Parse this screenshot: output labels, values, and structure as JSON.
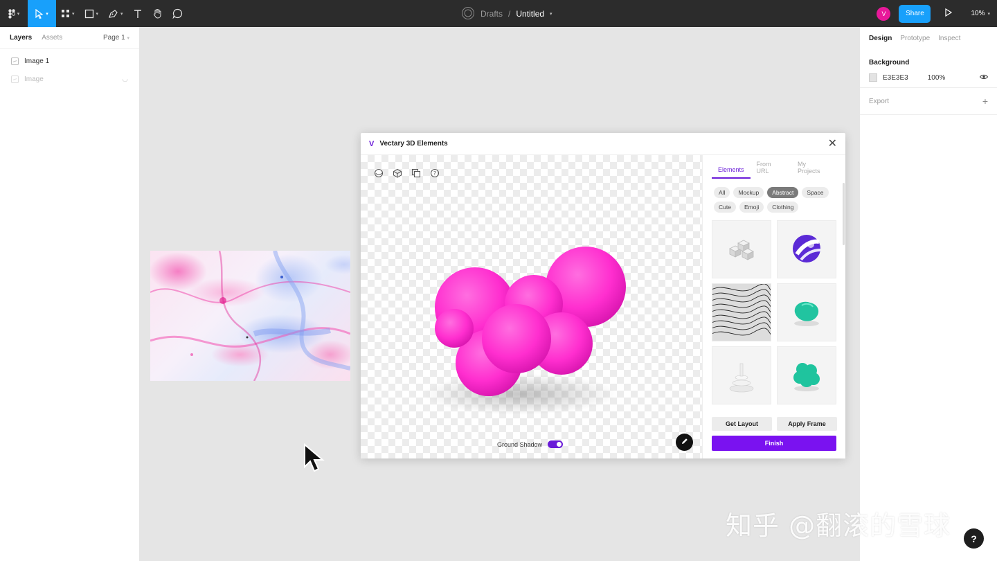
{
  "toolbar": {
    "tools": [
      {
        "name": "main-menu",
        "icon": "figma-logo-icon"
      },
      {
        "name": "move-tool",
        "icon": "cursor-arrow-icon",
        "active": true
      },
      {
        "name": "frame-tool",
        "icon": "frame-grid-icon"
      },
      {
        "name": "shape-tool",
        "icon": "rectangle-icon"
      },
      {
        "name": "pen-tool",
        "icon": "pen-icon"
      },
      {
        "name": "text-tool",
        "icon": "text-t-icon"
      },
      {
        "name": "hand-tool",
        "icon": "hand-icon"
      },
      {
        "name": "comment-tool",
        "icon": "speech-bubble-icon"
      }
    ],
    "breadcrumb_folder": "Drafts",
    "breadcrumb_sep": "/",
    "file_name": "Untitled",
    "avatar_initial": "V",
    "share_label": "Share",
    "zoom": "10%",
    "accent": "#18a0fb"
  },
  "left_panel": {
    "tab_layers": "Layers",
    "tab_assets": "Assets",
    "page": "Page 1",
    "layers": [
      {
        "label": "Image 1",
        "dim": false
      },
      {
        "label": "Image",
        "dim": true
      }
    ]
  },
  "right_panel": {
    "tab_design": "Design",
    "tab_prototype": "Prototype",
    "tab_inspect": "Inspect",
    "background_title": "Background",
    "bg_hex": "E3E3E3",
    "bg_opacity": "100%",
    "export_label": "Export"
  },
  "plugin": {
    "logo": "V",
    "title": "Vectary 3D Elements",
    "ground_shadow_label": "Ground Shadow",
    "tabs": [
      "Elements",
      "From URL",
      "My Projects"
    ],
    "chips": [
      "All",
      "Mockup",
      "Abstract",
      "Space",
      "Cute",
      "Emoji",
      "Clothing"
    ],
    "active_chip": "Abstract",
    "thumbnails": [
      {
        "icon": "white-cubes-icon"
      },
      {
        "icon": "purple-sphere-icon"
      },
      {
        "icon": "wavy-lines-icon"
      },
      {
        "icon": "teal-blob-icon"
      },
      {
        "icon": "white-rings-icon"
      },
      {
        "icon": "teal-cluster-icon"
      }
    ],
    "get_layout_label": "Get Layout",
    "apply_frame_label": "Apply Frame",
    "finish_label": "Finish",
    "brand_color": "#7a12f0",
    "blob_color": "#ff2ecf"
  },
  "watermark": "知乎 @翻滚的雪球",
  "help_label": "?"
}
